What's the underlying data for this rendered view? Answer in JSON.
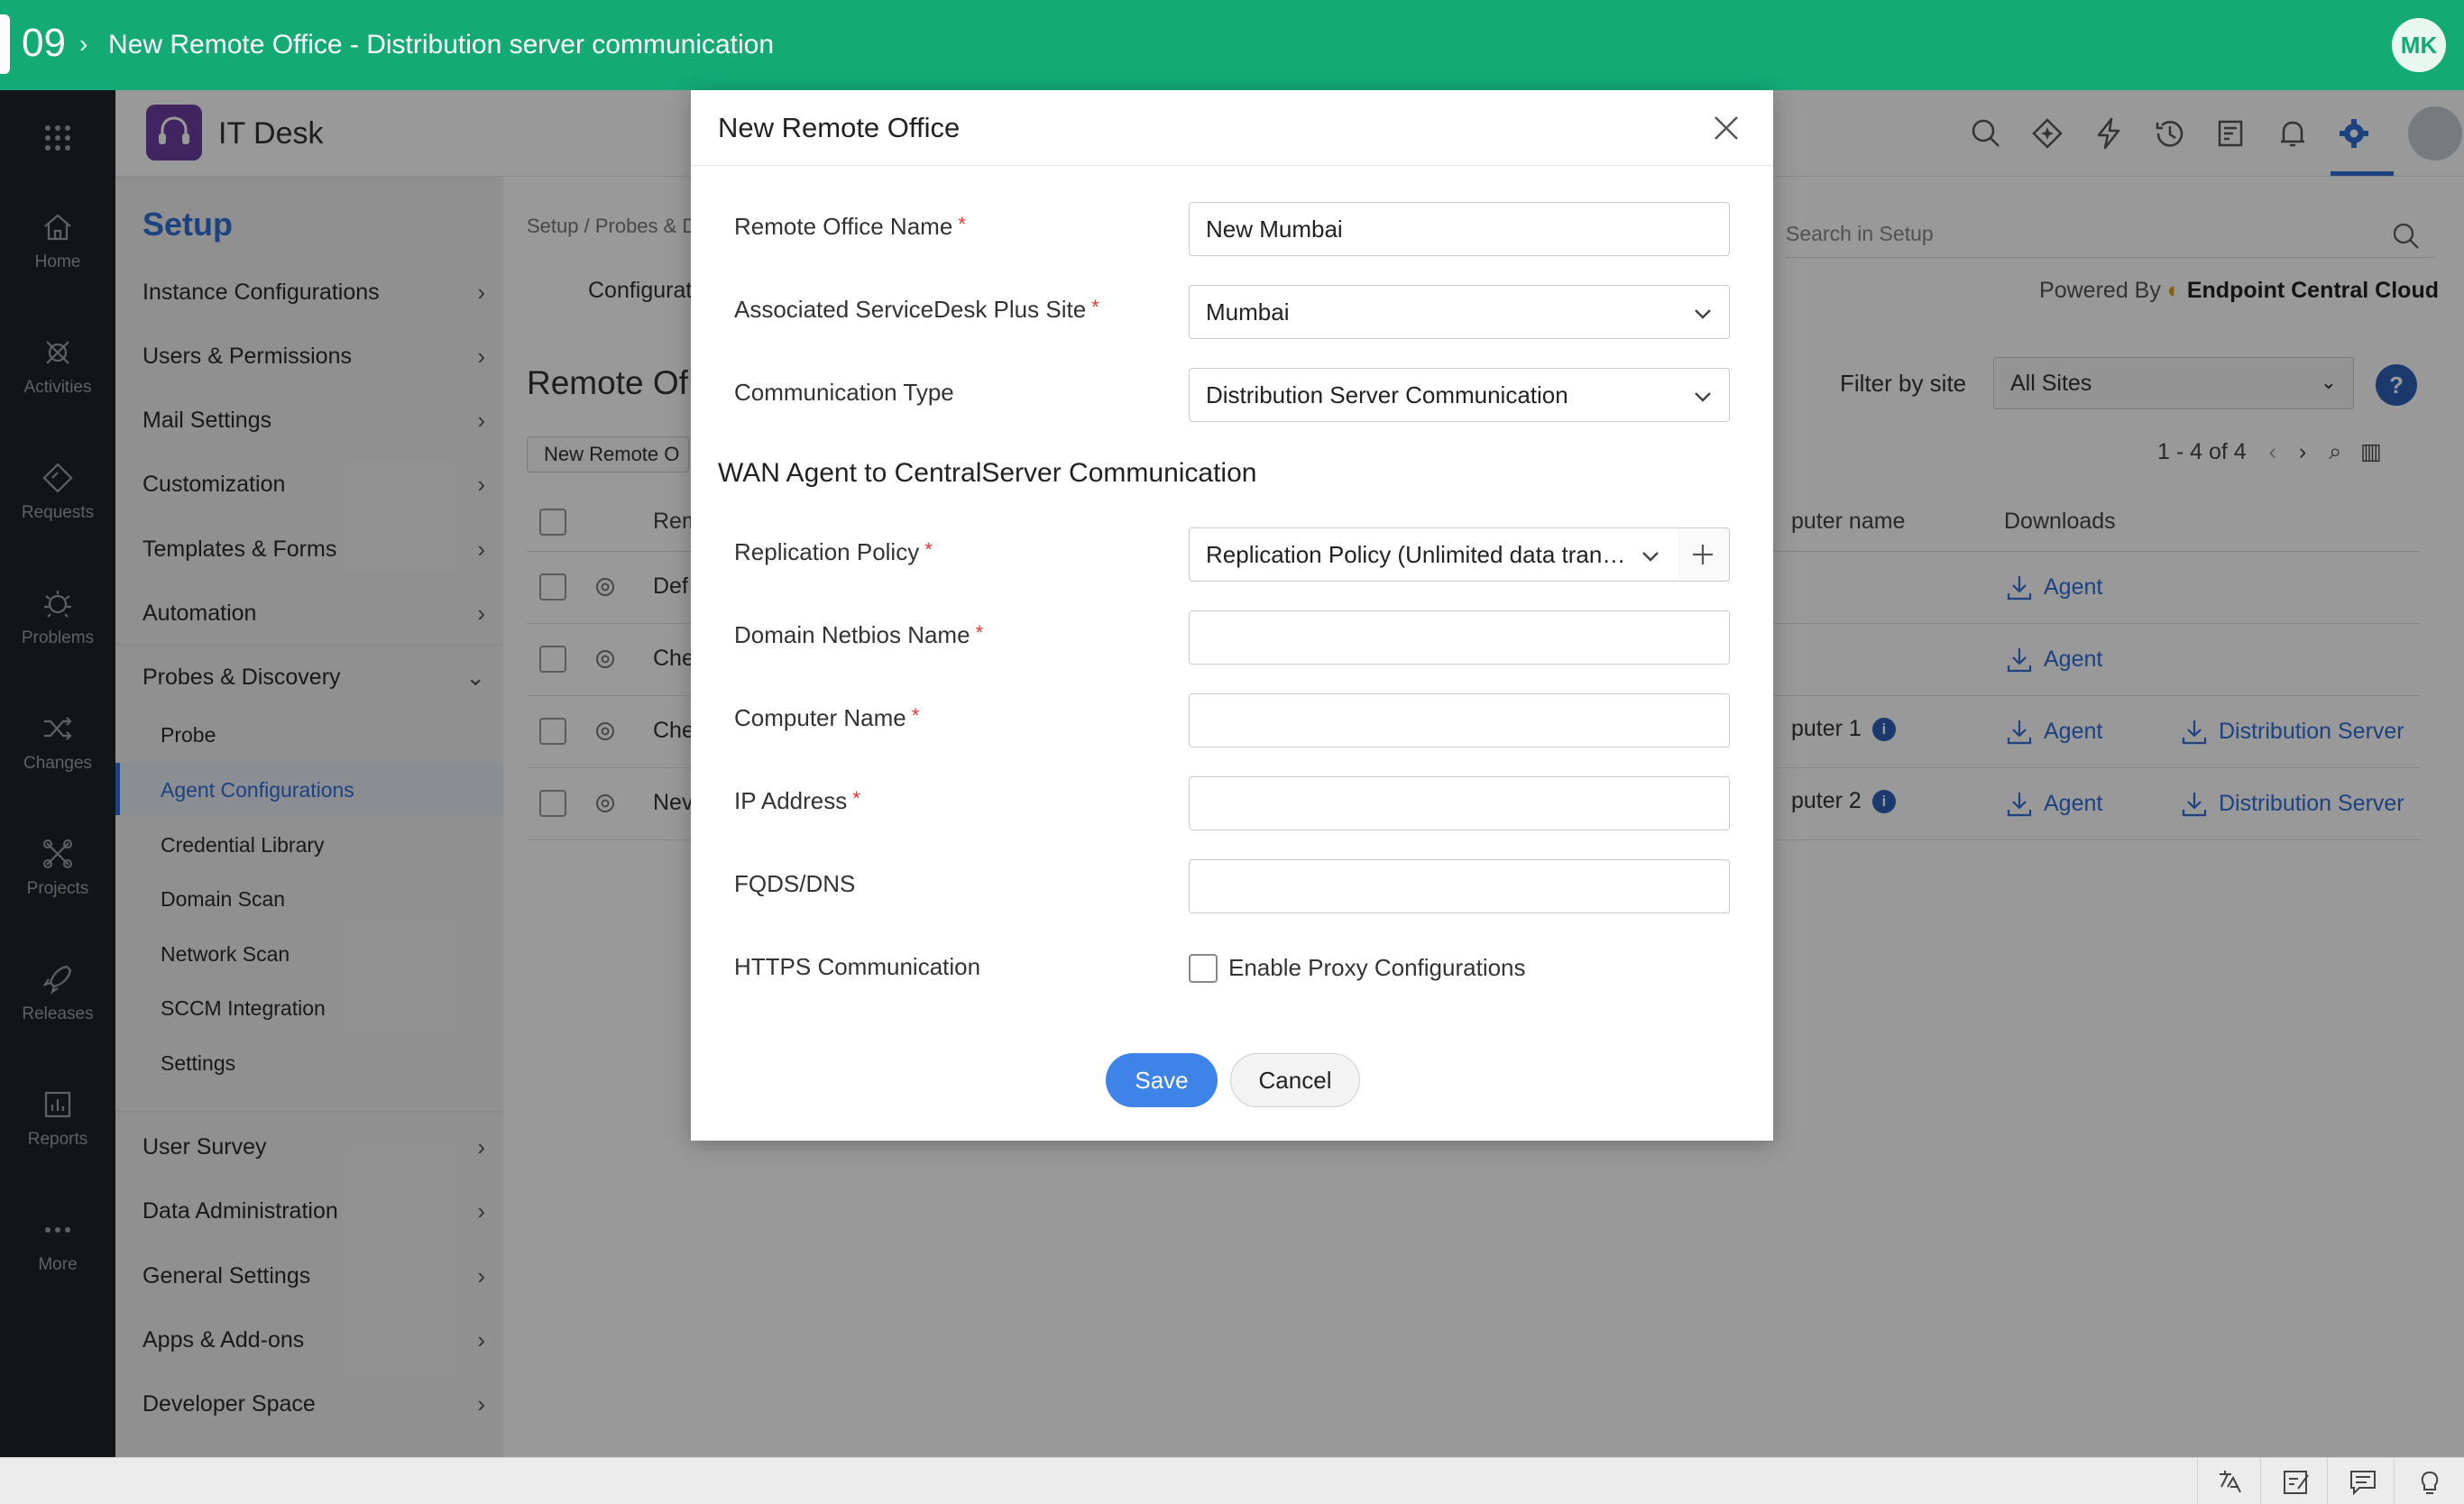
{
  "topbar": {
    "step": "09",
    "title": "New Remote Office - Distribution server communication",
    "user_initials": "MK"
  },
  "rail": {
    "items": [
      {
        "label": "Home",
        "icon": "home-icon"
      },
      {
        "label": "Activities",
        "icon": "activities-icon"
      },
      {
        "label": "Requests",
        "icon": "requests-icon"
      },
      {
        "label": "Problems",
        "icon": "problems-icon"
      },
      {
        "label": "Changes",
        "icon": "changes-icon"
      },
      {
        "label": "Projects",
        "icon": "projects-icon"
      },
      {
        "label": "Releases",
        "icon": "releases-icon"
      },
      {
        "label": "Reports",
        "icon": "reports-icon"
      },
      {
        "label": "More",
        "icon": "more-icon"
      }
    ]
  },
  "header": {
    "app_name": "IT Desk"
  },
  "setup": {
    "title": "Setup",
    "items": [
      "Instance Configurations",
      "Users & Permissions",
      "Mail Settings",
      "Customization",
      "Templates & Forms",
      "Automation",
      "Probes & Discovery"
    ],
    "sub_items": [
      "Probe",
      "Agent Configurations",
      "Credential Library",
      "Domain Scan",
      "Network Scan",
      "SCCM Integration",
      "Settings"
    ],
    "lower_items": [
      "User Survey",
      "Data Administration",
      "General Settings",
      "Apps & Add-ons",
      "Developer Space"
    ]
  },
  "main": {
    "breadcrumb": "Setup / Probes & D",
    "tab": "Configurat",
    "heading": "Remote Of",
    "new_button": "New Remote O",
    "search_placeholder": "Search in Setup",
    "powered_by": "Powered By",
    "powered_brand": "Endpoint Central Cloud",
    "filter_label": "Filter by site",
    "filter_value": "All Sites",
    "help": "?",
    "pager": "1 - 4 of 4",
    "columns": {
      "name": "Rem",
      "computer": "puter name",
      "downloads": "Downloads"
    },
    "rows": [
      {
        "name": "Def",
        "computer": "",
        "agent": "Agent",
        "dist": "",
        "info": false
      },
      {
        "name": "Che",
        "computer": "",
        "agent": "Agent",
        "dist": "",
        "info": false
      },
      {
        "name": "Che",
        "computer": "puter 1",
        "agent": "Agent",
        "dist": "Distribution Server",
        "info": true
      },
      {
        "name": "Nev",
        "computer": "puter 2",
        "agent": "Agent",
        "dist": "Distribution Server",
        "info": true
      }
    ]
  },
  "modal": {
    "title": "New Remote Office",
    "section_title": "WAN Agent to CentralServer Communication",
    "fields": {
      "remote_office_name": {
        "label": "Remote Office Name",
        "value": "New Mumbai"
      },
      "site": {
        "label": "Associated ServiceDesk Plus Site",
        "value": "Mumbai"
      },
      "comm_type": {
        "label": "Communication Type",
        "value": "Distribution Server Communication"
      },
      "replication_policy": {
        "label": "Replication Policy",
        "value": "Replication Policy (Unlimited data transf..."
      },
      "domain_netbios": {
        "label": "Domain Netbios Name",
        "value": ""
      },
      "computer_name": {
        "label": "Computer Name",
        "value": ""
      },
      "ip_address": {
        "label": "IP Address",
        "value": ""
      },
      "fqdn": {
        "label": "FQDS/DNS",
        "value": ""
      },
      "https": {
        "label": "HTTPS Communication"
      }
    },
    "proxy_label": "Enable Proxy Configurations",
    "required_mark": "*",
    "save": "Save",
    "cancel": "Cancel"
  },
  "colors": {
    "brand_green": "#13aa76",
    "accent_blue": "#3e84e8",
    "rail_bg": "#1e2428"
  }
}
